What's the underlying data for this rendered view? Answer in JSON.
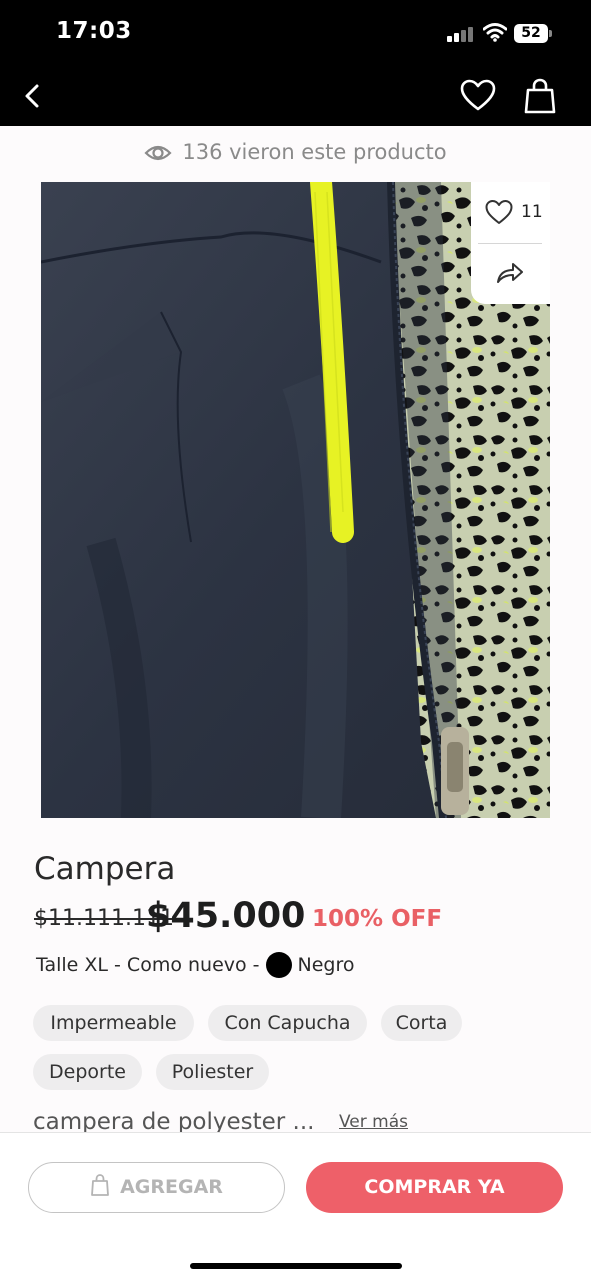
{
  "status_bar": {
    "time": "17:03",
    "battery": "52"
  },
  "product": {
    "views_text": "136 vieron este producto",
    "likes": "11",
    "title": "Campera",
    "original_price": "$11.111.111",
    "price": "$45.000",
    "discount": "100% OFF",
    "details_text": "Talle XL - Como nuevo -",
    "color_name": "Negro",
    "tags": [
      "Impermeable",
      "Con Capucha",
      "Corta",
      "Deporte",
      "Poliester"
    ],
    "description": "campera de polyester ...",
    "see_more": "Ver más"
  },
  "actions": {
    "add_label": "AGREGAR",
    "buy_label": "COMPRAR YA"
  },
  "colors": {
    "accent": "#ee6069",
    "discount": "#e96065"
  }
}
